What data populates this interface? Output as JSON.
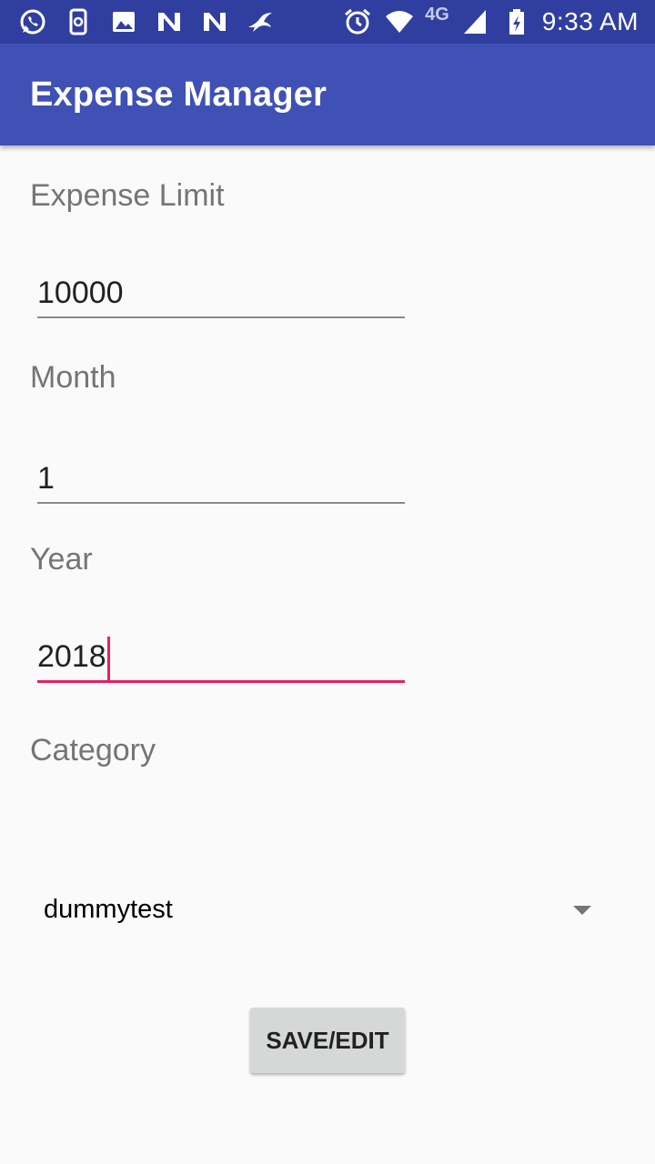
{
  "status_bar": {
    "network": "4G",
    "time": "9:33 AM",
    "left_icons": [
      "whatsapp-icon",
      "phone-sync-icon",
      "gallery-icon",
      "n-app-icon",
      "n-app-icon",
      "bird-app-icon"
    ],
    "right_icons": [
      "alarm-icon",
      "wifi-icon",
      "signal-icon",
      "battery-charging-icon"
    ]
  },
  "app_bar": {
    "title": "Expense Manager"
  },
  "form": {
    "expense_limit": {
      "label": "Expense Limit",
      "value": "10000"
    },
    "month": {
      "label": "Month",
      "value": "1"
    },
    "year": {
      "label": "Year",
      "value": "2018"
    },
    "category": {
      "label": "Category",
      "selected": "dummytest"
    },
    "save_button": "SAVE/EDIT"
  },
  "colors": {
    "status_bar": "#303f9f",
    "app_bar": "#3f51b5",
    "accent": "#e91e63",
    "background": "#fafafa"
  }
}
